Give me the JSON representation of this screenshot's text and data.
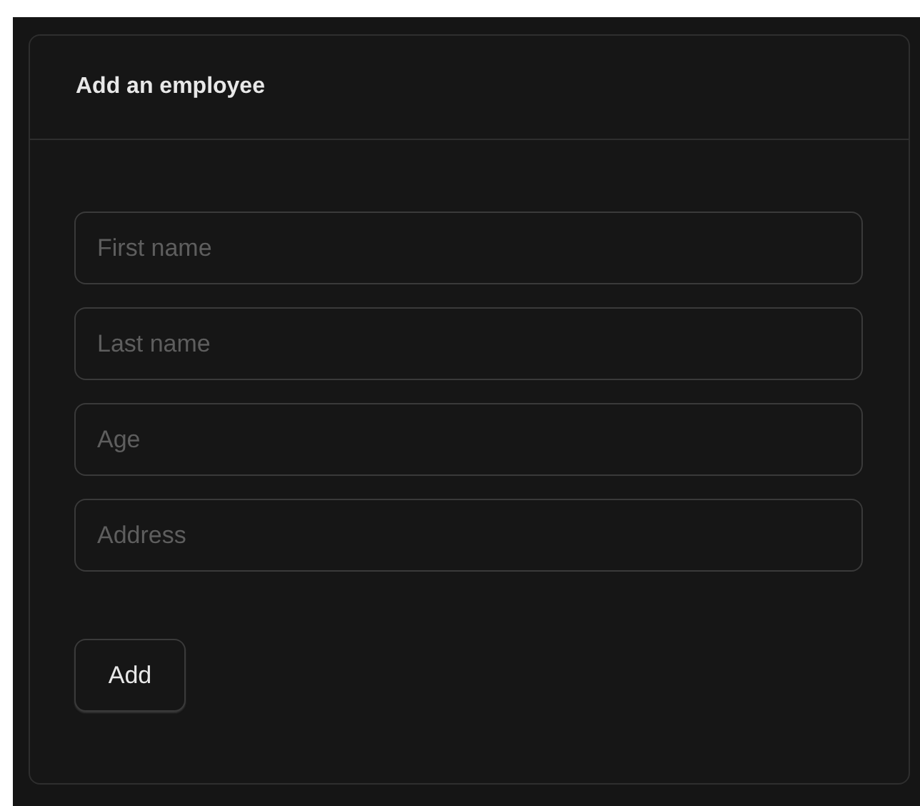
{
  "card": {
    "title": "Add an employee"
  },
  "fields": [
    {
      "placeholder": "First name"
    },
    {
      "placeholder": "Last name"
    },
    {
      "placeholder": "Age"
    },
    {
      "placeholder": "Address"
    }
  ],
  "buttons": [
    "Add"
  ]
}
